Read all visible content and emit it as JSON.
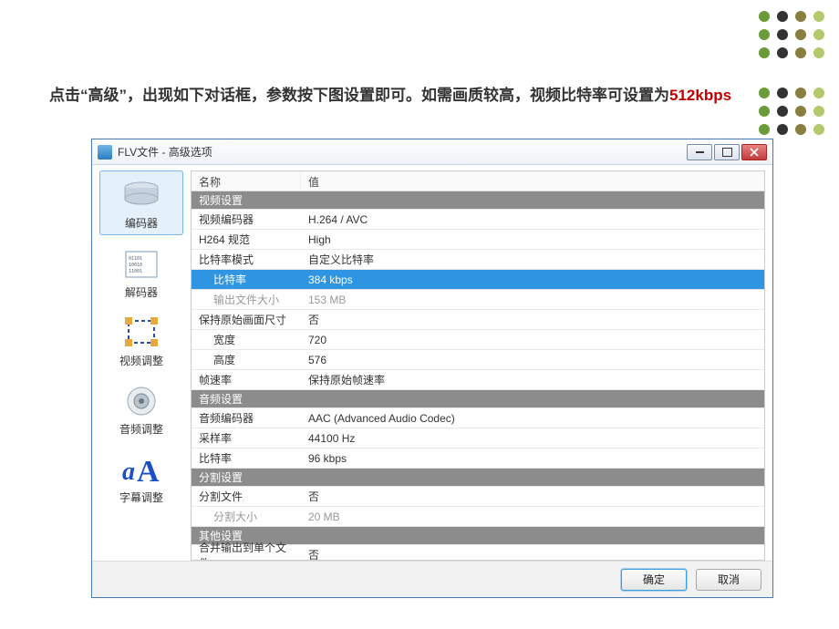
{
  "instruction": {
    "pre": "点击",
    "lq": "“",
    "btnword": "高级",
    "rq": "”",
    "mid": "，出现如下对话框，参数按下图设置即可。如需画质较高，视频比特率可设置为",
    "hl": "512kbps"
  },
  "dialog": {
    "title": "FLV文件 - 高级选项",
    "columns": {
      "name": "名称",
      "value": "值"
    },
    "ok": "确定",
    "cancel": "取消"
  },
  "sidebar": {
    "encoder": "编码器",
    "decoder": "解码器",
    "videoadj": "视频调整",
    "audioadj": "音频调整",
    "subtitle": "字幕调整"
  },
  "sections": {
    "video": "视频设置",
    "audio": "音频设置",
    "split": "分割设置",
    "other": "其他设置"
  },
  "rows": {
    "venc_l": "视频编码器",
    "venc_v": "H.264 / AVC",
    "h264p_l": "H264 规范",
    "h264p_v": "High",
    "brmode_l": "比特率模式",
    "brmode_v": "自定义比特率",
    "br_l": "比特率",
    "br_v": "384 kbps",
    "outsize_l": "输出文件大小",
    "outsize_v": "153 MB",
    "keep_l": "保持原始画面尺寸",
    "keep_v": "否",
    "w_l": "宽度",
    "w_v": "720",
    "h_l": "高度",
    "h_v": "576",
    "fps_l": "帧速率",
    "fps_v": "保持原始帧速率",
    "aenc_l": "音频编码器",
    "aenc_v": "AAC (Advanced Audio Codec)",
    "srate_l": "采样率",
    "srate_v": "44100 Hz",
    "abr_l": "比特率",
    "abr_v": "96 kbps",
    "split_l": "分割文件",
    "split_v": "否",
    "ssize_l": "分割大小",
    "ssize_v": "20 MB",
    "merge_l": "合并输出到单个文件",
    "merge_v": "否"
  }
}
